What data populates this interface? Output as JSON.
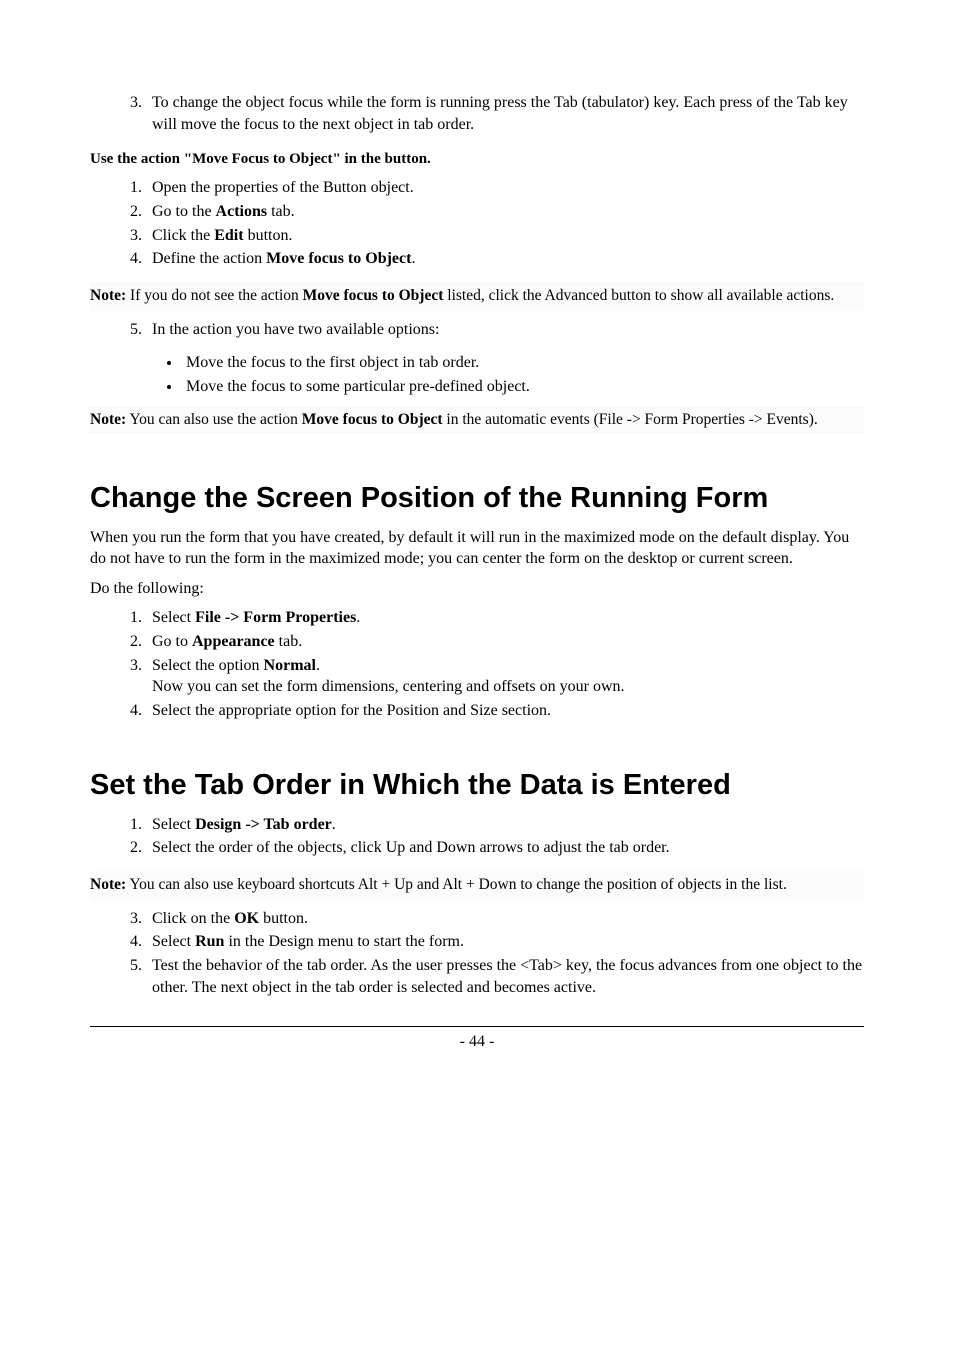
{
  "sec0": {
    "ol3_item3_a": "To change the object focus while the form is running press the Tab (tabulator) key. Each press of the Tab key will move the focus to the next object in tab order.",
    "sub_heading": "Use the action \"Move Focus to Object\" in the button.",
    "ol1": {
      "i1": "Open the properties of the Button object.",
      "i2_a": "Go to the ",
      "i2_b": "Actions",
      "i2_c": " tab.",
      "i3_a": "Click the ",
      "i3_b": "Edit",
      "i3_c": " button.",
      "i4_a": "Define the action ",
      "i4_b": "Move focus to Object",
      "i4_c": "."
    },
    "note1_a": "Note:",
    "note1_b": " If you do not see the action ",
    "note1_c": "Move focus to Object",
    "note1_d": " listed, click the Advanced button to show all available actions.",
    "ol5_item5": "In the action you have two available options:",
    "ul_i1": "Move the focus to the first object in tab order.",
    "ul_i2": "Move the focus to some particular pre-defined object.",
    "note2_a": "Note:",
    "note2_b": " You can also use the action ",
    "note2_c": "Move focus to Object",
    "note2_d": " in the automatic events (File -> Form Properties -> Events)."
  },
  "sec1": {
    "h": "Change the Screen Position of the Running Form",
    "p1": "When you run the form that you have created, by default it will run in the maximized mode on the default display. You do not have to run the form in the maximized mode; you can center the form on the desktop or current screen.",
    "p2": "Do the following:",
    "ol": {
      "i1_a": "Select ",
      "i1_b": "File -> Form Properties",
      "i1_c": ".",
      "i2_a": "Go to ",
      "i2_b": "Appearance",
      "i2_c": " tab.",
      "i3_a": "Select the option ",
      "i3_b": "Normal",
      "i3_c": ".",
      "i3_extra": " Now you can set the form dimensions, centering and offsets on your own.",
      "i4": "Select the appropriate option for the Position and Size section."
    }
  },
  "sec2": {
    "h": "Set the Tab Order in Which the Data is Entered",
    "ol_a": {
      "i1_a": "Select ",
      "i1_b": "Design -> Tab order",
      "i1_c": ".",
      "i2": "Select the order of the objects, click Up and Down arrows to adjust the tab order."
    },
    "note_a": "Note:",
    "note_b": " You can also use keyboard shortcuts Alt + Up and Alt + Down to change the position of objects in the list.",
    "ol_b": {
      "i3_a": "Click on the ",
      "i3_b": "OK",
      "i3_c": " button.",
      "i4_a": "Select ",
      "i4_b": "Run",
      "i4_c": " in the Design menu to start the form.",
      "i5": "Test the behavior of the tab order. As the user presses the <Tab> key, the focus advances from one object to the other. The next object in the tab order is selected and becomes active."
    }
  },
  "footer": {
    "page": "- 44 -"
  }
}
